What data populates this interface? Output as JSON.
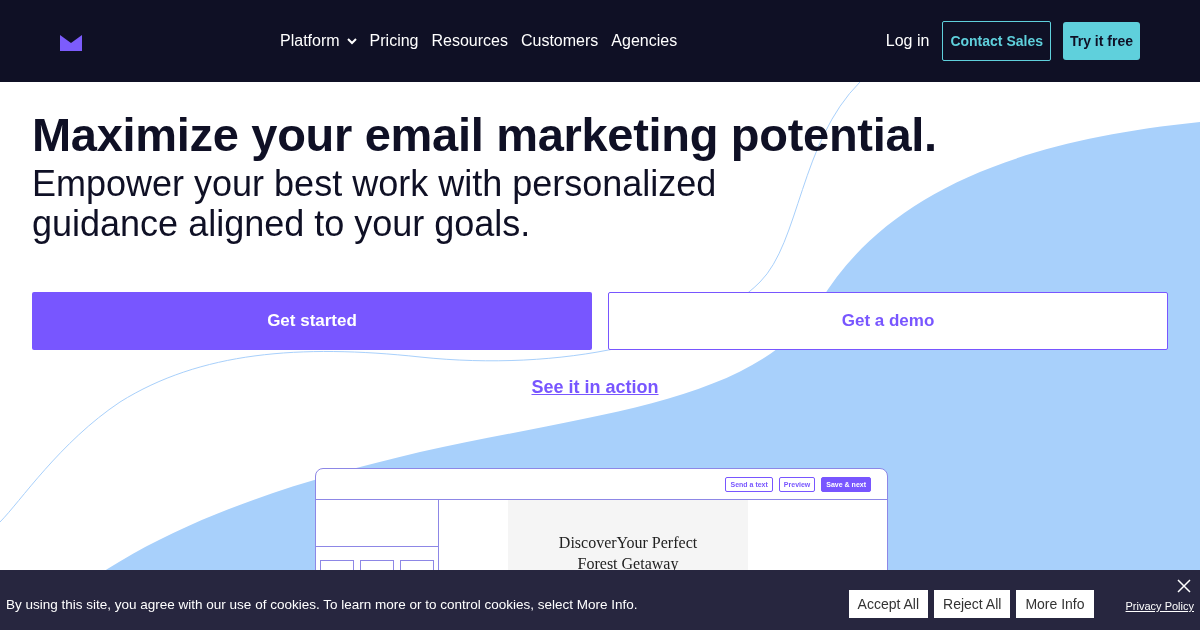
{
  "nav": {
    "menu": [
      {
        "label": "Platform",
        "dropdown": true
      },
      {
        "label": "Pricing",
        "dropdown": false
      },
      {
        "label": "Resources",
        "dropdown": false
      },
      {
        "label": "Customers",
        "dropdown": false
      },
      {
        "label": "Agencies",
        "dropdown": false
      }
    ],
    "login": "Log in",
    "contact": "Contact Sales",
    "trial": "Try it free"
  },
  "hero": {
    "title": "Maximize your email marketing potential.",
    "subtitle": "Empower your best work with personalized guidance aligned to your goals.",
    "primary": "Get started",
    "secondary": "Get a demo",
    "link": "See it in action"
  },
  "mockup": {
    "buttons": [
      {
        "label": "Send a text",
        "kind": "outline"
      },
      {
        "label": "Preview",
        "kind": "outline"
      },
      {
        "label": "Save & next",
        "kind": "filled"
      }
    ],
    "heading": [
      "DiscoverYour Perfect",
      "Forest Getaway"
    ]
  },
  "cookies": {
    "text": "By using this site, you agree with our use of cookies. To learn more or to control cookies, select More Info.",
    "buttons": [
      "Accept All",
      "Reject All",
      "More Info"
    ],
    "policy": "Privacy Policy"
  }
}
